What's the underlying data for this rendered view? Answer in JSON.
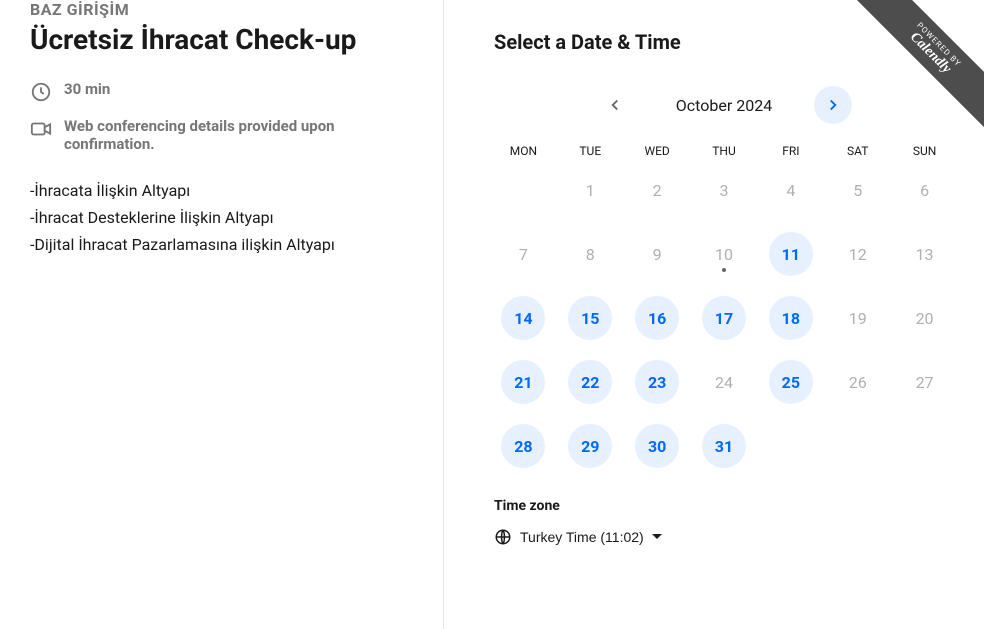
{
  "host": "BAZ GİRİŞİM",
  "event_title": "Ücretsiz İhracat Check-up",
  "duration_label": "30 min",
  "location_label": "Web conferencing details provided upon confirmation.",
  "description_lines": [
    "-İhracata İlişkin Altyapı",
    "-İhracat Desteklerine İlişkin Altyapı",
    "-Dijital İhracat Pazarlamasına ilişkin Altyapı"
  ],
  "select_title": "Select a Date & Time",
  "month_label": "October 2024",
  "weekdays": [
    "MON",
    "TUE",
    "WED",
    "THU",
    "FRI",
    "SAT",
    "SUN"
  ],
  "days": [
    {
      "n": "",
      "s": "blank"
    },
    {
      "n": "1",
      "s": "unavailable"
    },
    {
      "n": "2",
      "s": "unavailable"
    },
    {
      "n": "3",
      "s": "unavailable"
    },
    {
      "n": "4",
      "s": "unavailable"
    },
    {
      "n": "5",
      "s": "unavailable"
    },
    {
      "n": "6",
      "s": "unavailable"
    },
    {
      "n": "7",
      "s": "unavailable"
    },
    {
      "n": "8",
      "s": "unavailable"
    },
    {
      "n": "9",
      "s": "unavailable"
    },
    {
      "n": "10",
      "s": "unavailable",
      "today": true
    },
    {
      "n": "11",
      "s": "available"
    },
    {
      "n": "12",
      "s": "unavailable"
    },
    {
      "n": "13",
      "s": "unavailable"
    },
    {
      "n": "14",
      "s": "available"
    },
    {
      "n": "15",
      "s": "available"
    },
    {
      "n": "16",
      "s": "available"
    },
    {
      "n": "17",
      "s": "available"
    },
    {
      "n": "18",
      "s": "available"
    },
    {
      "n": "19",
      "s": "unavailable"
    },
    {
      "n": "20",
      "s": "unavailable"
    },
    {
      "n": "21",
      "s": "available"
    },
    {
      "n": "22",
      "s": "available"
    },
    {
      "n": "23",
      "s": "available"
    },
    {
      "n": "24",
      "s": "unavailable"
    },
    {
      "n": "25",
      "s": "available"
    },
    {
      "n": "26",
      "s": "unavailable"
    },
    {
      "n": "27",
      "s": "unavailable"
    },
    {
      "n": "28",
      "s": "available"
    },
    {
      "n": "29",
      "s": "available"
    },
    {
      "n": "30",
      "s": "available"
    },
    {
      "n": "31",
      "s": "available"
    },
    {
      "n": "",
      "s": "blank"
    },
    {
      "n": "",
      "s": "blank"
    },
    {
      "n": "",
      "s": "blank"
    }
  ],
  "timezone": {
    "label": "Time zone",
    "value": "Turkey Time (11:02)"
  },
  "badge": {
    "small": "POWERED BY",
    "big": "Calendly"
  }
}
